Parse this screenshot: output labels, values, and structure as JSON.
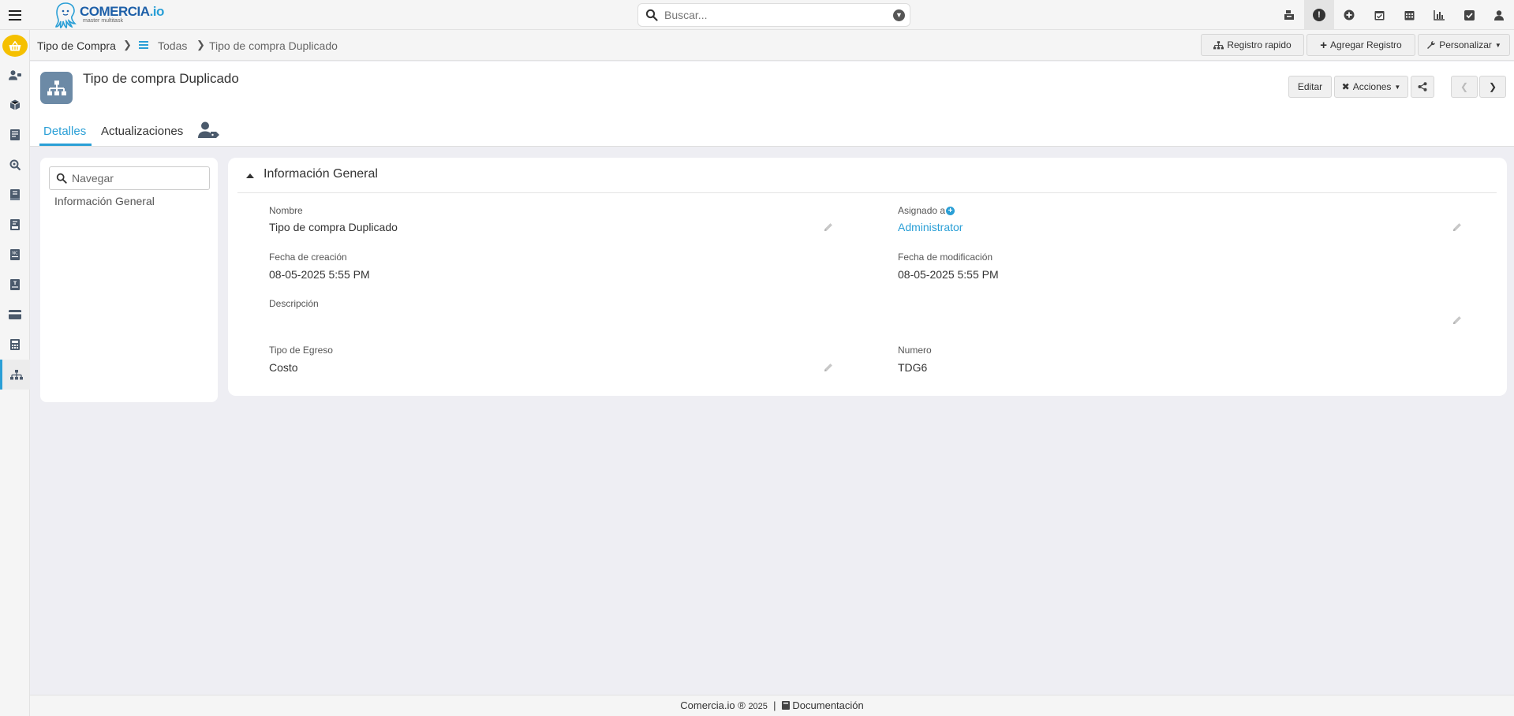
{
  "app": {
    "logo_name": "COMERCIA",
    "logo_suffix": ".io",
    "logo_tagline": "master multitask"
  },
  "search": {
    "placeholder": "Buscar..."
  },
  "top_icons": [
    "cash-register-icon",
    "alert-icon",
    "plus-circle-icon",
    "calendar-check-icon",
    "calendar-icon",
    "bar-chart-icon",
    "checkbox-icon",
    "user-icon"
  ],
  "sidebar_icons": [
    "contacts-icon",
    "box-icon",
    "news-icon",
    "search-report-icon",
    "ledger-icon",
    "invoice-icon",
    "credit-note-icon",
    "receipt-icon",
    "card-icon",
    "calculator-icon",
    "sitemap-icon"
  ],
  "breadcrumb": {
    "module": "Tipo de Compra",
    "list": "Todas",
    "current": "Tipo de compra Duplicado"
  },
  "header_actions": {
    "quick": "Registro rapido",
    "add": "Agregar Registro",
    "customize": "Personalizar"
  },
  "record": {
    "title": "Tipo de compra Duplicado",
    "edit_label": "Editar",
    "actions_label": "Acciones"
  },
  "tabs": {
    "details": "Detalles",
    "updates": "Actualizaciones"
  },
  "nav": {
    "placeholder": "Navegar",
    "items": [
      "Información General"
    ]
  },
  "section": {
    "title": "Información General",
    "fields": {
      "name": {
        "label": "Nombre",
        "value": "Tipo de compra Duplicado"
      },
      "assigned": {
        "label": "Asignado a",
        "value": "Administrator"
      },
      "created": {
        "label": "Fecha de creación",
        "value": "08-05-2025 5:55 PM"
      },
      "modified": {
        "label": "Fecha de modificación",
        "value": "08-05-2025 5:55 PM"
      },
      "description": {
        "label": "Descripción",
        "value": ""
      },
      "expense_type": {
        "label": "Tipo de Egreso",
        "value": "Costo"
      },
      "number": {
        "label": "Numero",
        "value": "TDG6"
      }
    }
  },
  "footer": {
    "brand": "Comercia.io ®",
    "year": "2025",
    "separator": "|",
    "docs": "Documentación"
  },
  "colors": {
    "accent": "#2a9fd6",
    "logo_blue": "#1d5fa8",
    "basket": "#f5c000",
    "record_icon_bg": "#6c8aa6"
  }
}
